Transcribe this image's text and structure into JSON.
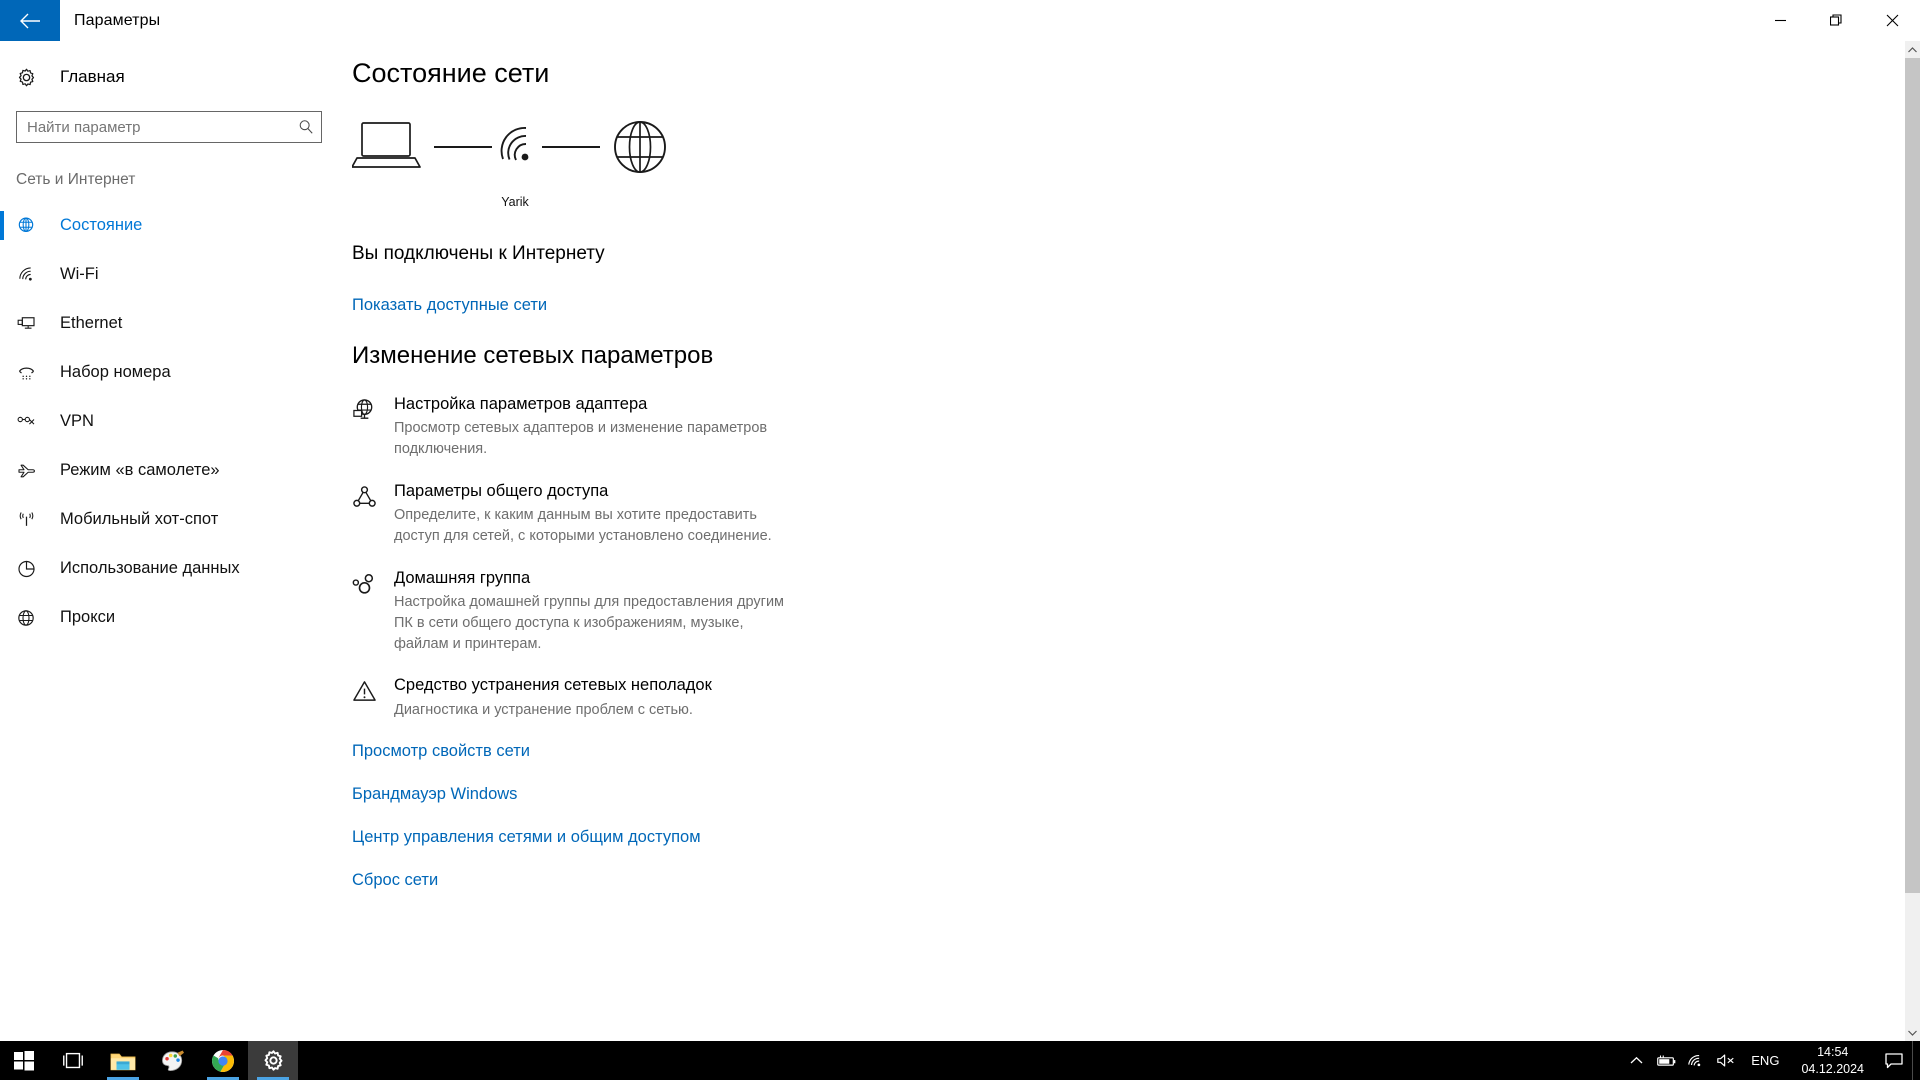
{
  "window": {
    "title": "Параметры",
    "back_icon": "back-arrow-icon",
    "minimize_label": "—",
    "maximize_label": "❐",
    "close_label": "✕"
  },
  "sidebar": {
    "home": {
      "label": "Главная",
      "icon": "gear-icon"
    },
    "search": {
      "placeholder": "Найти параметр",
      "value": "",
      "icon": "search-icon"
    },
    "section_label": "Сеть и Интернет",
    "items": [
      {
        "label": "Состояние",
        "icon": "globe-icon",
        "selected": true
      },
      {
        "label": "Wi-Fi",
        "icon": "wifi-icon",
        "selected": false
      },
      {
        "label": "Ethernet",
        "icon": "ethernet-icon",
        "selected": false
      },
      {
        "label": "Набор номера",
        "icon": "dialup-phone-icon",
        "selected": false
      },
      {
        "label": "VPN",
        "icon": "vpn-icon",
        "selected": false
      },
      {
        "label": "Режим «в самолете»",
        "icon": "airplane-icon",
        "selected": false
      },
      {
        "label": "Мобильный хот-спот",
        "icon": "hotspot-icon",
        "selected": false
      },
      {
        "label": "Использование данных",
        "icon": "pie-chart-icon",
        "selected": false
      },
      {
        "label": "Прокси",
        "icon": "globe-icon",
        "selected": false
      }
    ]
  },
  "main": {
    "page_title": "Состояние сети",
    "diagram": {
      "device_icon": "laptop-icon",
      "network_icon": "wifi-signal-icon",
      "internet_icon": "globe-icon",
      "network_name": "Yarik"
    },
    "status_text": "Вы подключены к Интернету",
    "available_networks_link": "Показать доступные сети",
    "section_title": "Изменение сетевых параметров",
    "options": [
      {
        "icon": "adapter-globe-icon",
        "title": "Настройка параметров адаптера",
        "desc": "Просмотр сетевых адаптеров и изменение параметров подключения."
      },
      {
        "icon": "sharing-icon",
        "title": "Параметры общего доступа",
        "desc": "Определите, к каким данным вы хотите предоставить доступ для сетей, с которыми установлено соединение."
      },
      {
        "icon": "homegroup-icon",
        "title": "Домашняя группа",
        "desc": "Настройка домашней группы для предоставления другим ПК в сети общего доступа к изображениям, музыке, файлам и принтерам."
      },
      {
        "icon": "warning-triangle-icon",
        "title": "Средство устранения сетевых неполадок",
        "desc": "Диагностика и устранение проблем с сетью."
      }
    ],
    "links": [
      "Просмотр свойств сети",
      "Брандмауэр Windows",
      "Центр управления сетями и общим доступом",
      "Сброс сети"
    ]
  },
  "taskbar": {
    "start_icon": "windows-start-icon",
    "items": [
      {
        "icon": "task-view-icon",
        "active": false,
        "running": false
      },
      {
        "icon": "file-explorer-icon",
        "active": false,
        "running": true
      },
      {
        "icon": "paint-icon",
        "active": false,
        "running": false
      },
      {
        "icon": "chrome-icon",
        "active": false,
        "running": true
      },
      {
        "icon": "settings-gear-icon",
        "active": true,
        "running": true
      }
    ],
    "tray": {
      "chevron_icon": "chevron-up-icon",
      "battery_icon": "battery-charging-icon",
      "wifi_icon": "wifi-icon",
      "volume_icon": "speaker-muted-icon",
      "language": "ENG",
      "time": "14:54",
      "date": "04.12.2024",
      "action_center_icon": "notification-icon"
    }
  },
  "colors": {
    "accent": "#0078d7",
    "link": "#0067b8",
    "titlebar_back": "#0067b8"
  }
}
